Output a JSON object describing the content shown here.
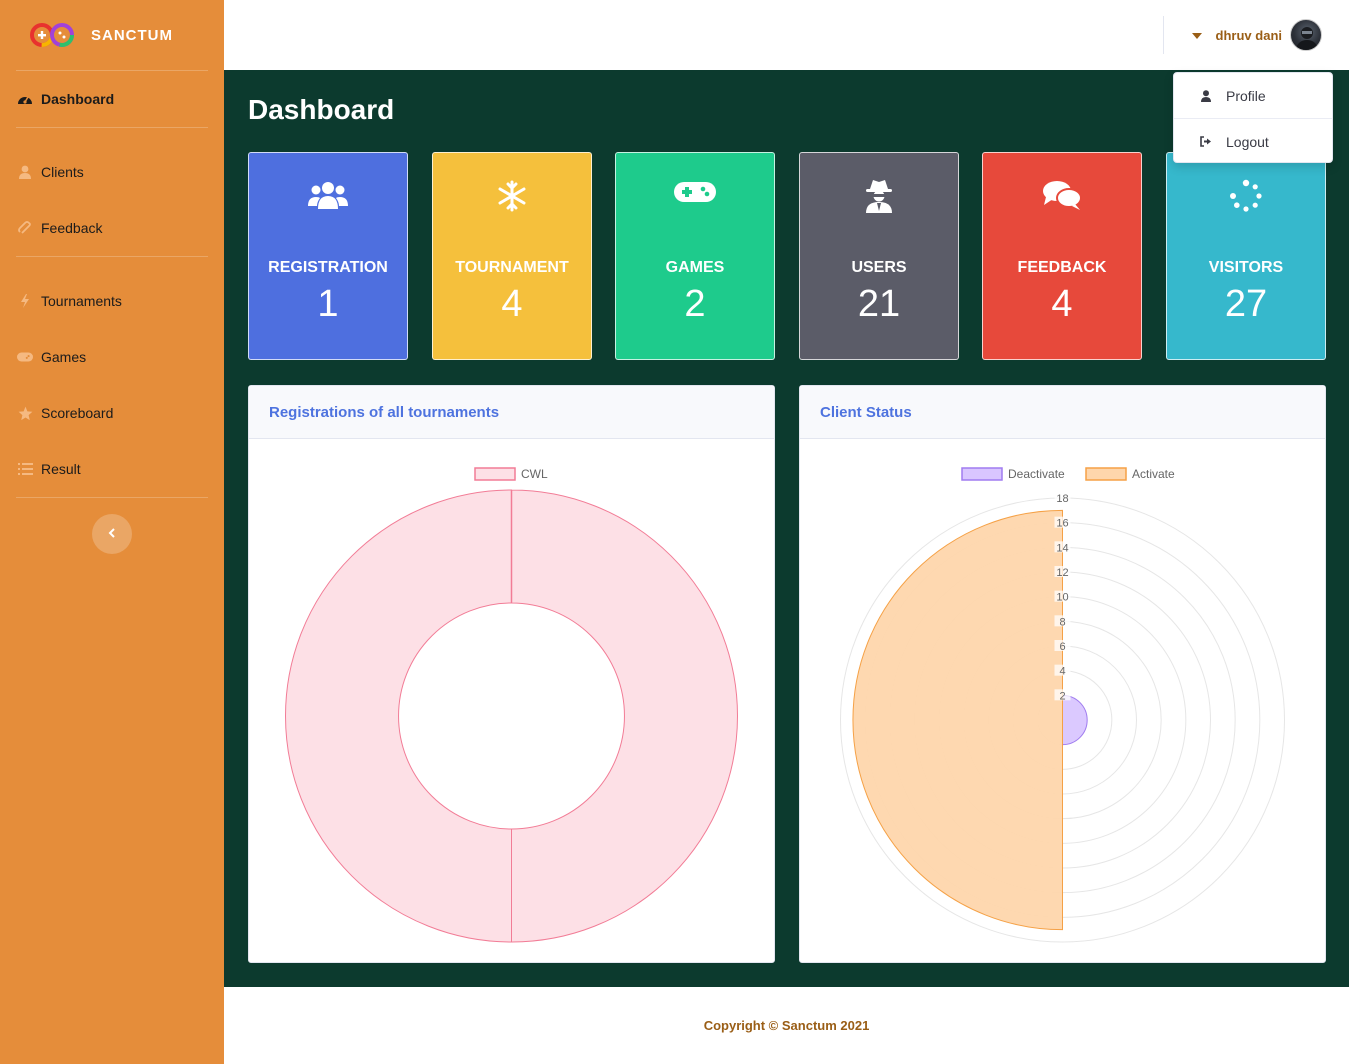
{
  "brand": {
    "name": "SANCTUM"
  },
  "sidebar": {
    "items": [
      {
        "label": "Dashboard",
        "icon": "tachometer-icon"
      },
      {
        "label": "Clients",
        "icon": "user-icon"
      },
      {
        "label": "Feedback",
        "icon": "paperclip-icon"
      },
      {
        "label": "Tournaments",
        "icon": "bolt-icon"
      },
      {
        "label": "Games",
        "icon": "gamepad-icon"
      },
      {
        "label": "Scoreboard",
        "icon": "star-icon"
      },
      {
        "label": "Result",
        "icon": "list-icon"
      }
    ],
    "toggle_icon": "chevron-left-icon"
  },
  "topbar": {
    "user_name": "dhruv dani"
  },
  "dropdown": {
    "profile": "Profile",
    "logout": "Logout"
  },
  "page": {
    "title": "Dashboard"
  },
  "cards": [
    {
      "label": "REGISTRATION",
      "value": "1",
      "color": "#4e6fdf",
      "icon": "users-icon"
    },
    {
      "label": "TOURNAMENT",
      "value": "4",
      "color": "#f5c03c",
      "icon": "snowflake-icon"
    },
    {
      "label": "GAMES",
      "value": "2",
      "color": "#1ecb8c",
      "icon": "gamepad-icon"
    },
    {
      "label": "USERS",
      "value": "21",
      "color": "#5b5c68",
      "icon": "user-secret-icon"
    },
    {
      "label": "FEEDBACK",
      "value": "4",
      "color": "#e7493b",
      "icon": "comments-icon"
    },
    {
      "label": "VISITORS",
      "value": "27",
      "color": "#36b8cc",
      "icon": "spinner-icon"
    }
  ],
  "panels": {
    "registrations": {
      "title": "Registrations of all tournaments"
    },
    "client_status": {
      "title": "Client Status"
    }
  },
  "chart_data": [
    {
      "type": "doughnut",
      "categories": [
        "CWL"
      ],
      "values": [
        1
      ],
      "legend": "top",
      "colors": {
        "fill": "#fde0e6",
        "border": "#f27c96"
      }
    },
    {
      "type": "polarArea",
      "categories": [
        "Deactivate",
        "Activate"
      ],
      "values": [
        2,
        17
      ],
      "rlim": [
        0,
        18
      ],
      "ticks": [
        "2",
        "4",
        "6",
        "8",
        "10",
        "12",
        "14",
        "16",
        "18"
      ],
      "legend": "top",
      "colors": {
        "Deactivate": {
          "fill": "#d9c6ff",
          "border": "#a07cf0"
        },
        "Activate": {
          "fill": "#fed6ac",
          "border": "#f5a146"
        }
      }
    }
  ],
  "footer": {
    "text": "Copyright © Sanctum 2021"
  }
}
